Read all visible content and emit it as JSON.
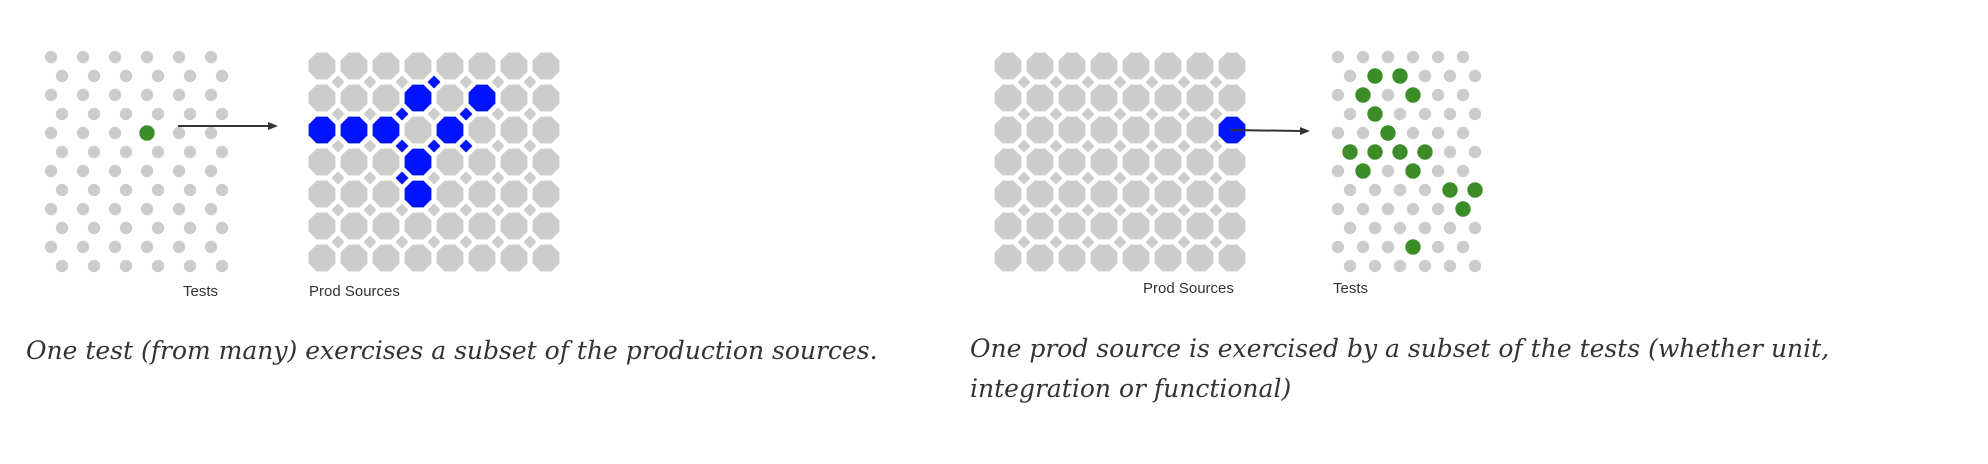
{
  "figures": [
    {
      "id": "left",
      "tests_label": "Tests",
      "prod_label": "Prod Sources",
      "caption": "One test (from many) exercises a subset of the production sources.",
      "highlight_color": "#0014ff",
      "test_color": "#3c8c28",
      "grid_color": "#cccccc"
    },
    {
      "id": "right",
      "prod_label": "Prod Sources",
      "tests_label": "Tests",
      "caption": "One prod source is exercised by a subset of the tests (whether unit, integration or functional)",
      "highlight_color": "#0014ff",
      "test_color": "#3c8c28",
      "grid_color": "#cccccc"
    }
  ]
}
